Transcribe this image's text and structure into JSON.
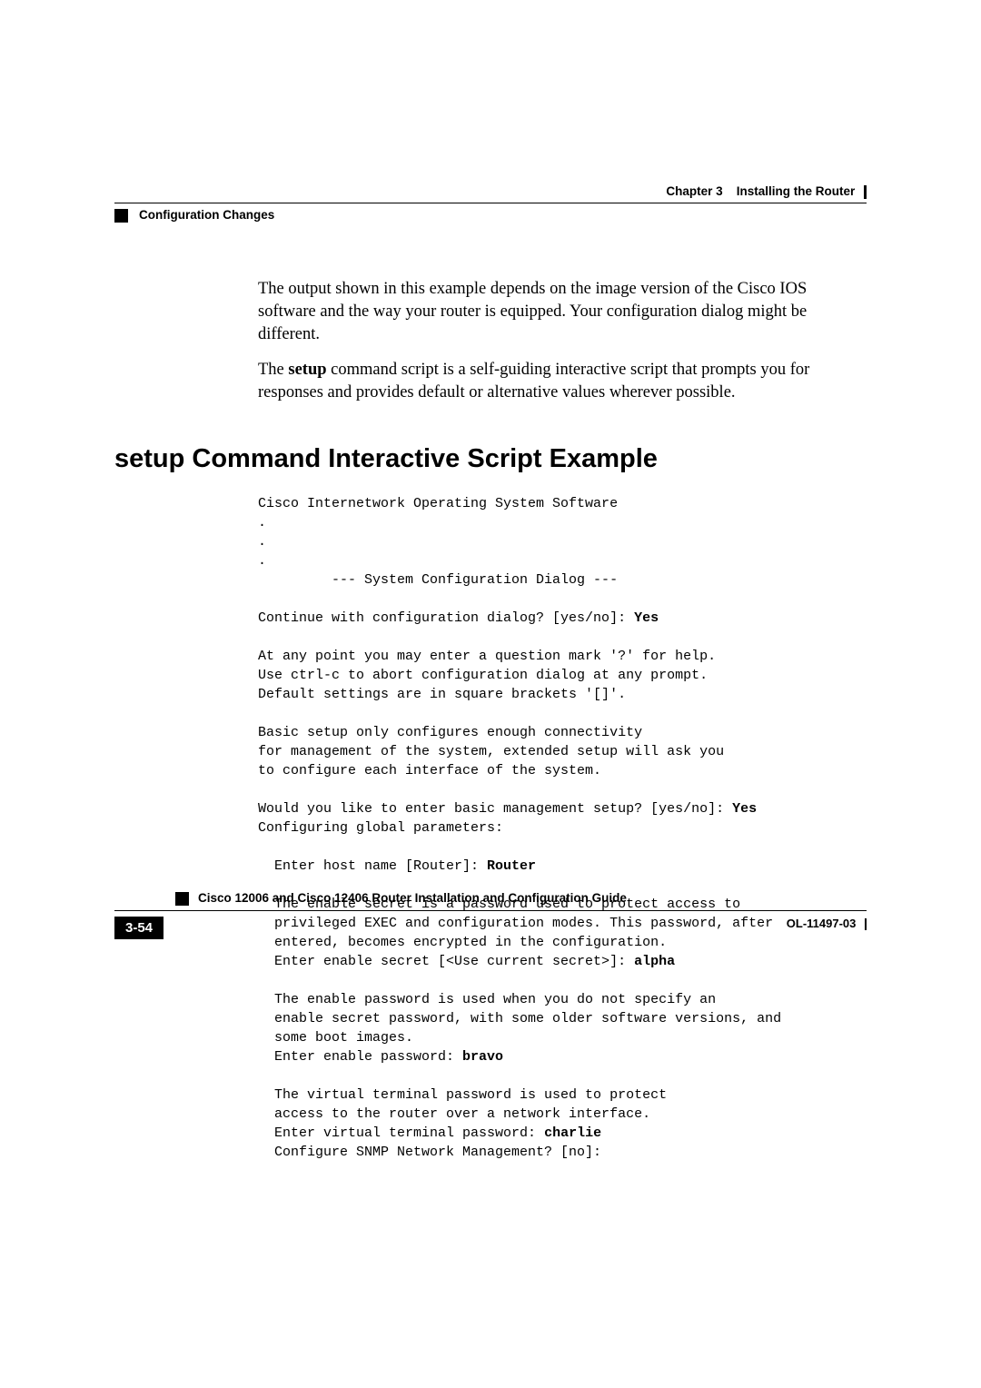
{
  "header": {
    "left": "Configuration Changes",
    "right_prefix": "Chapter 3",
    "right_title": "Installing the Router"
  },
  "body": {
    "para1": "The output shown in this example depends on the image version of the Cisco IOS software and the way your router is equipped. Your configuration dialog might be different.",
    "para2_a": "The ",
    "para2_bold": "setup",
    "para2_b": " command script is a self-guiding interactive script that prompts you for responses and provides default or alternative values wherever possible."
  },
  "heading": "setup Command Interactive Script Example",
  "code": {
    "l01": "Cisco Internetwork Operating System Software",
    "l02": ".",
    "l03": ".",
    "l04": ".",
    "l05": "         --- System Configuration Dialog ---",
    "l06": "",
    "l07a": "Continue with configuration dialog? [yes/no]: ",
    "l07b": "Yes",
    "l08": "",
    "l09": "At any point you may enter a question mark '?' for help.",
    "l10": "Use ctrl-c to abort configuration dialog at any prompt.",
    "l11": "Default settings are in square brackets '[]'.",
    "l12": "",
    "l13": "Basic setup only configures enough connectivity",
    "l14": "for management of the system, extended setup will ask you",
    "l15": "to configure each interface of the system.",
    "l16": "",
    "l17a": "Would you like to enter basic management setup? [yes/no]: ",
    "l17b": "Yes",
    "l18": "Configuring global parameters:",
    "l19": "",
    "l20a": "  Enter host name [Router]: ",
    "l20b": "Router",
    "l21": "",
    "l22": "  The enable secret is a password used to protect access to",
    "l23": "  privileged EXEC and configuration modes. This password, after",
    "l24": "  entered, becomes encrypted in the configuration.",
    "l25a": "  Enter enable secret [<Use current secret>]: ",
    "l25b": "alpha",
    "l26": "",
    "l27": "  The enable password is used when you do not specify an",
    "l28": "  enable secret password, with some older software versions, and",
    "l29": "  some boot images.",
    "l30a": "  Enter enable password: ",
    "l30b": "bravo",
    "l31": "",
    "l32": "  The virtual terminal password is used to protect",
    "l33": "  access to the router over a network interface.",
    "l34a": "  Enter virtual terminal password: ",
    "l34b": "charlie",
    "l35": "  Configure SNMP Network Management? [no]:"
  },
  "footer": {
    "title": "Cisco 12006 and Cisco 12406 Router Installation and Configuration Guide",
    "page": "3-54",
    "ref": "OL-11497-03"
  }
}
